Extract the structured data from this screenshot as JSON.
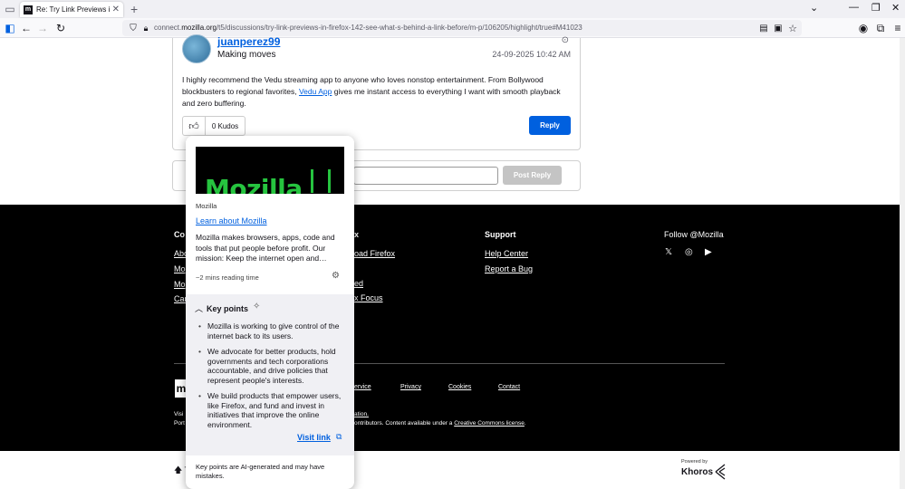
{
  "browser": {
    "tab_title": "Re: Try Link Previews in Firefox",
    "tab_favicon": "m",
    "url_domain": "connect.",
    "url_host": "mozilla.org",
    "url_path": "/t5/discussions/try-link-previews-in-firefox-142-see-what-s-behind-a-link-before/m-p/106205/highlight/true#M41023"
  },
  "post": {
    "author": "juanperez99",
    "rank": "Making moves",
    "date": "24-09-2025 10:42 AM",
    "body_before": "I highly recommend the Vedu streaming app to anyone who loves nonstop entertainment. From Bollywood blockbusters to regional favorites, ",
    "body_link": "Vedu App",
    "body_after": " gives me instant access to everything I want with smooth playback and zero buffering.",
    "kudos": "0 Kudos",
    "reply_label": "Reply"
  },
  "reply_box": {
    "post_reply_label": "Post Reply"
  },
  "footer": {
    "col1_head": "Co",
    "col1_links": [
      "Abo",
      "Mo",
      "Mo",
      "Car"
    ],
    "col2_head": "x",
    "col2_links": [
      "oad Firefox",
      "ed",
      "x Focus"
    ],
    "support_head": "Support",
    "support_links": [
      "Help Center",
      "Report a Bug"
    ],
    "follow": "Follow @Mozilla",
    "legal": [
      "ervice",
      "Privacy",
      "Cookies",
      "Contact"
    ],
    "small1_a": "Visi",
    "small1_b": "ation.",
    "small2_a": "Port",
    "small2_b": "ontributors. Content available under a ",
    "small2_link": "Creative Commons license",
    "small2_end": "."
  },
  "bottom": {
    "back_top": "T",
    "powered": "Powered by",
    "khoros": "Khoros"
  },
  "preview": {
    "image_text": "Mozilla",
    "site": "Mozilla",
    "title": "Learn about Mozilla",
    "description": "Mozilla makes browsers, apps, code and tools that put people before profit. Our mission: Keep the internet open and…",
    "reading_time": "~2 mins reading time",
    "key_points_title": "Key points",
    "key_points": [
      "Mozilla is working to give control of the internet back to its users.",
      "We advocate for better products, hold governments and tech corporations accountable, and drive policies that represent people's interests.",
      "We build products that empower users, like Firefox, and fund and invest in initiatives that improve the online environment."
    ],
    "visit_link": "Visit link",
    "note": "Key points are AI-generated and may have mistakes."
  },
  "colors": {
    "accent": "#0060df",
    "mozilla_green": "#26c43f",
    "footer_bg": "#000000"
  }
}
